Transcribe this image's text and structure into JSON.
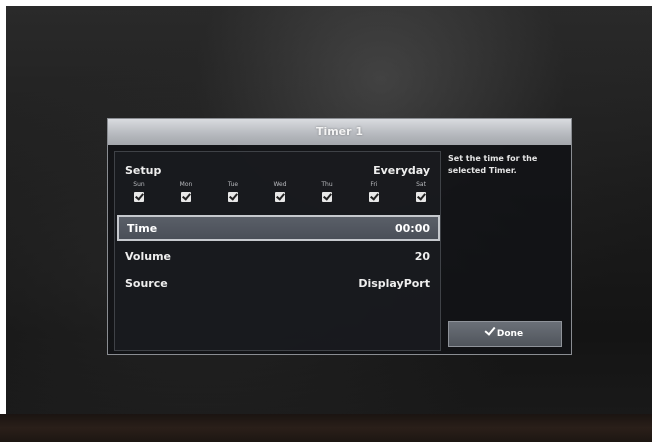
{
  "dialog": {
    "title": "Timer 1",
    "help_text": "Set the time for the selected Timer.",
    "done_label": "Done"
  },
  "setup": {
    "label": "Setup",
    "value": "Everyday",
    "days": [
      {
        "name": "Sun",
        "checked": true
      },
      {
        "name": "Mon",
        "checked": true
      },
      {
        "name": "Tue",
        "checked": true
      },
      {
        "name": "Wed",
        "checked": true
      },
      {
        "name": "Thu",
        "checked": true
      },
      {
        "name": "Fri",
        "checked": true
      },
      {
        "name": "Sat",
        "checked": true
      }
    ]
  },
  "time": {
    "label": "Time",
    "value": "00:00"
  },
  "volume": {
    "label": "Volume",
    "value": "20"
  },
  "source": {
    "label": "Source",
    "value": "DisplayPort"
  },
  "colors": {
    "selected_row": "#4e535c",
    "dialog_bg": "#121316",
    "title_bar": "#b8bbc0"
  },
  "icons": {
    "day_check": "checkbox-checked-icon",
    "done": "checkmark-icon"
  }
}
